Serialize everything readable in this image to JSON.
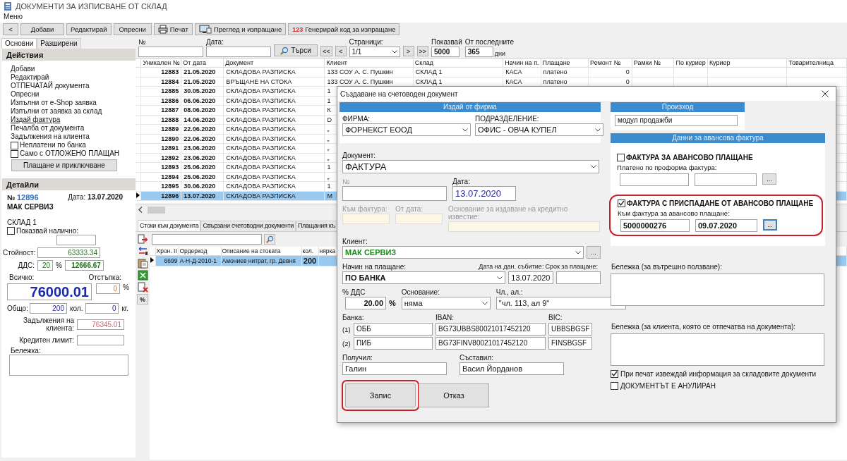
{
  "window": {
    "title": "ДОКУМЕНТИ ЗА ИЗПИСВАНЕ ОТ СКЛАД",
    "menu": "Меню"
  },
  "toolbar": [
    {
      "label": "<",
      "kind": "plain"
    },
    {
      "label": "Добави",
      "kind": "plain"
    },
    {
      "label": "Редактирай",
      "kind": "plain"
    },
    {
      "label": "Опресни",
      "kind": "plain"
    },
    {
      "label": "Печат",
      "kind": "printer"
    },
    {
      "label": "Преглед и изпращане",
      "kind": "monitor"
    },
    {
      "label": "Генерирай код за изпращане",
      "kind": "numbers",
      "icon_text": "123"
    }
  ],
  "left_tabs": [
    {
      "label": "Основни",
      "selected": true
    },
    {
      "label": "Разширени",
      "selected": false
    }
  ],
  "actions": {
    "title": "Действия",
    "items": [
      {
        "label": "Добави",
        "kind": "link"
      },
      {
        "label": "Редактирай",
        "kind": "link"
      },
      {
        "label": "ОТПЕЧАТАЙ документа",
        "kind": "link"
      },
      {
        "label": "Опресни",
        "kind": "link"
      },
      {
        "label": "Изпълни от e-Shop заявка",
        "kind": "link"
      },
      {
        "label": "Изпълни от заявка за склад",
        "kind": "link"
      },
      {
        "label": "Издай фактура",
        "kind": "underlined"
      },
      {
        "label": "Печалба от документа",
        "kind": "link"
      },
      {
        "label": "Задължения на клиента",
        "kind": "link"
      },
      {
        "label": "Неплатени по банка",
        "kind": "checkbox",
        "checked": false
      },
      {
        "label": "Само с ОТЛОЖЕНО ПЛАЩАН",
        "kind": "checkbox",
        "checked": false
      }
    ],
    "button": "Плащане и приключване"
  },
  "details": {
    "title": "Детайли",
    "number_label": "№",
    "number": "12896",
    "date_label": "Дата:",
    "date": "13.07.2020",
    "client": "МАК СЕРВИЗ",
    "warehouse": "СКЛАД 1",
    "show_available": {
      "label": "Показвай налично:",
      "checked": false
    },
    "value_label": "Стойност:",
    "value": "63333.34",
    "vat_label": "ДДС:",
    "vat_rate": "20",
    "vat_unit": "%",
    "vat": "12666.67",
    "total_label": "Всичко:",
    "total": "76000.01",
    "discount_label": "Отстъпка:",
    "discount": "0",
    "discount_unit": "%",
    "sum_label": "Общо:",
    "qty": "200",
    "qty_unit": "кол.",
    "weight": "0",
    "weight_unit": "кг.",
    "debt_label": "Задължения на клиента:",
    "debt": "76345.01",
    "credit_label": "Кредитен лимит:",
    "note_label": "Бележка:"
  },
  "filter": {
    "number_label": "№",
    "date_label": "Дата:",
    "search_button": "Търси",
    "pages_label": "Страници:",
    "page": "1/1",
    "nav_back": [
      "<<",
      "<"
    ],
    "nav_fwd": [
      ">",
      ">>"
    ],
    "show_label": "Показвай",
    "show": "5000",
    "last_label": "От последните",
    "last": "365",
    "days": "дни"
  },
  "table": {
    "columns": [
      "Уникален №",
      "От дата",
      "Документ",
      "Клиент",
      "Склад",
      "Начин на п.",
      "Плащане",
      "Ремонт №",
      "Рамки №",
      "По куриер",
      "Куриер",
      "Товарителница"
    ],
    "rows": [
      {
        "selected": false,
        "cells": [
          "12883",
          "21.05.2020",
          "СКЛАДОВА РАЗПИСКА",
          "133 СОУ А. С. Пушкин",
          "СКЛАД 1",
          "КАСА",
          "платено",
          "0"
        ]
      },
      {
        "selected": false,
        "cells": [
          "12884",
          "21.05.2020",
          "ВРЪЩАНЕ НА СТОКА",
          "133 СОУ А. С. Пушкин",
          "СКЛАД 1",
          "КАСА",
          "платено",
          "0"
        ]
      },
      {
        "selected": false,
        "cells": [
          "12885",
          "30.05.2020",
          "СКЛАДОВА РАЗПИСКА",
          "1"
        ]
      },
      {
        "selected": false,
        "cells": [
          "12886",
          "06.06.2020",
          "СКЛАДОВА РАЗПИСКА",
          "1"
        ]
      },
      {
        "selected": false,
        "cells": [
          "12887",
          "08.06.2020",
          "СКЛАДОВА РАЗПИСКА",
          "К"
        ]
      },
      {
        "selected": false,
        "cells": [
          "12888",
          "14.06.2020",
          "СКЛАДОВА РАЗПИСКА",
          "D"
        ]
      },
      {
        "selected": false,
        "cells": [
          "12889",
          "22.06.2020",
          "СКЛАДОВА РАЗПИСКА",
          "„"
        ]
      },
      {
        "selected": false,
        "cells": [
          "12890",
          "22.06.2020",
          "СКЛАДОВА РАЗПИСКА",
          "„"
        ]
      },
      {
        "selected": false,
        "cells": [
          "12891",
          "23.06.2020",
          "СКЛАДОВА РАЗПИСКА",
          "„"
        ]
      },
      {
        "selected": false,
        "cells": [
          "12892",
          "23.06.2020",
          "СКЛАДОВА РАЗПИСКА",
          "„"
        ]
      },
      {
        "selected": false,
        "cells": [
          "12893",
          "25.06.2020",
          "СКЛАДОВА РАЗПИСКА",
          "1"
        ]
      },
      {
        "selected": false,
        "cells": [
          "12894",
          "25.06.2020",
          "СКЛАДОВА РАЗПИСКА",
          "„"
        ]
      },
      {
        "selected": false,
        "cells": [
          "12895",
          "30.06.2020",
          "СКЛАДОВА РАЗПИСКА",
          "1"
        ]
      },
      {
        "selected": true,
        "cells": [
          "12896",
          "13.07.2020",
          "СКЛАДОВА РАЗПИСКА",
          "М"
        ]
      }
    ]
  },
  "lower_tabs": [
    {
      "label": "Стоки към документа",
      "selected": true
    },
    {
      "label": "Свързани счетоводни документи",
      "selected": false
    },
    {
      "label": "Плащания къ",
      "selected": false
    }
  ],
  "side_tools": [
    {
      "kind": "export"
    },
    {
      "kind": "transfer"
    },
    {
      "kind": "paste"
    },
    {
      "kind": "excel"
    },
    {
      "kind": "delete"
    },
    {
      "kind": "text",
      "label": "%"
    }
  ],
  "goods": {
    "columns": [
      "Хрон. II",
      "Ордеркод",
      "Описание на стоката",
      "кол.",
      "нярка"
    ],
    "rows": [
      {
        "selected": true,
        "cells": [
          "6699",
          "А-Н-Д-2010-1",
          "Амониев нитрат, гр. Девня",
          "200"
        ]
      }
    ]
  },
  "dialog": {
    "title": "Създаване на счетоводен документ",
    "issuer": {
      "header": "Издай от фирма",
      "company_label": "ФИРМА:",
      "company": "ФОРНЕКСТ ЕООД",
      "division_label": "ПОДРАЗДЕЛЕНИЕ:",
      "division": "ОФИС - ОВЧА КУПЕЛ"
    },
    "document_label": "Документ:",
    "document": "ФАКТУРА",
    "number_label": "№",
    "date_label": "Дата:",
    "date": "13.07.2020",
    "to_invoice_label": "Към фактура:",
    "from_date_label": "От дата:",
    "reason_label": "Основание за издаване на кредитно известие:",
    "client_label": "Клиент:",
    "client": "МАК СЕРВИЗ",
    "more": "...",
    "payment_label": "Начин на плащане:",
    "payment": "ПО БАНКА",
    "tax_date_label": "Дата на дан. събитие:",
    "tax_date": "13.07.2020",
    "due_label": "Срок за плащане:",
    "vat_label": "% ДДС",
    "vat": "20.00",
    "vat_unit": "%",
    "basis_label": "Основание:",
    "basis": "няма",
    "article_label": "Чл., ал.:",
    "article": "\"чл. 113, ал 9\"",
    "banks": {
      "bank_label": "Банка:",
      "iban_label": "IBAN:",
      "bic_label": "BIC:",
      "rows": [
        {
          "index": "(1)",
          "bank": "ОББ",
          "iban": "BG73UBBS80021017452120",
          "bic": "UBBSBGSF"
        },
        {
          "index": "(2)",
          "bank": "ПИБ",
          "iban": "BG73FINV80021017452120",
          "bic": "FINSBGSF"
        }
      ]
    },
    "received_label": "Получил:",
    "received": "Галин",
    "author_label": "Съставил:",
    "author": "Васил Йорданов",
    "buttons": [
      {
        "label": "Запис",
        "highlighted": true
      },
      {
        "label": "Отказ",
        "highlighted": false
      }
    ],
    "origin": {
      "header": "Произход",
      "value": "модул продажби"
    },
    "advance": {
      "header": "Данни за авансова фактура",
      "options": [
        {
          "label": "ФАКТУРА ЗА АВАНСОВО ПЛАЩАНЕ",
          "checked": false,
          "highlighted": false,
          "field_label": "Платено по проформа фактура:",
          "more": "..."
        },
        {
          "label": "ФАКТУРА С ПРИСПАДАНЕ ОТ АВАНСОВО ПЛАЩАНЕ",
          "checked": true,
          "highlighted": true,
          "field_label": "Към фактура за авансово плащане:",
          "number": "5000000276",
          "date": "09.07.2020",
          "more": "..."
        }
      ]
    },
    "internal_note_label": "Бележка (за вътрешно ползване):",
    "client_note_label": "Бележка (за клиента, която се отпечатва на документа):",
    "checks": [
      {
        "label": "При печат извеждай информация за складовите документи",
        "checked": true
      },
      {
        "label": "ДОКУМЕНТЪТ Е АНУЛИРАН",
        "checked": false
      }
    ]
  }
}
